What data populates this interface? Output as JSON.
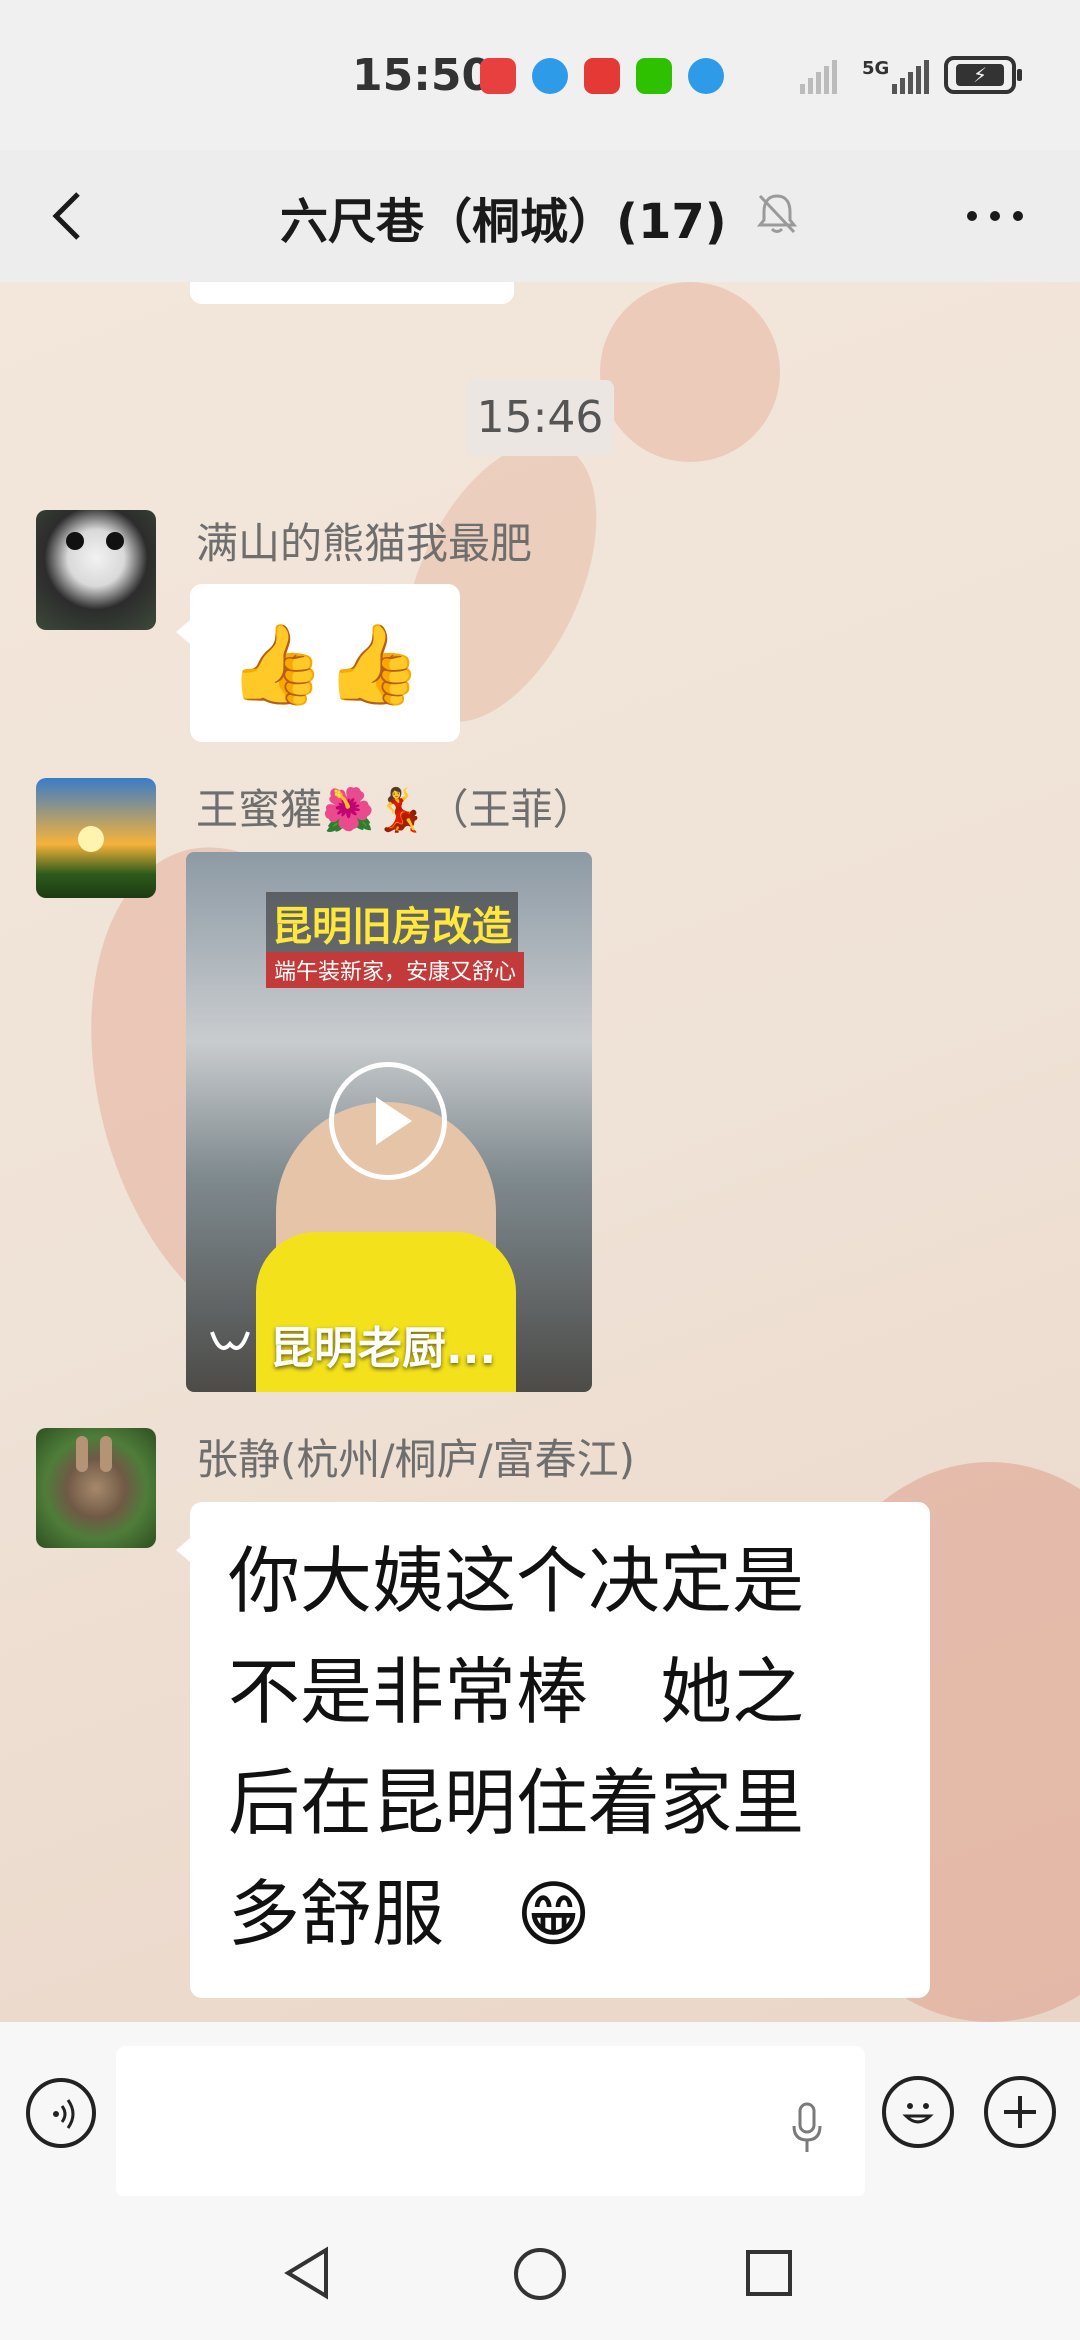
{
  "status_bar": {
    "time": "15:50",
    "network": "5G",
    "app_icons": [
      "huawei-app-icon",
      "browser-icon",
      "huawei-video-icon",
      "wechat-icon",
      "browser-icon"
    ]
  },
  "header": {
    "title": "六尺巷（桐城）(17)",
    "muted": true
  },
  "chat": {
    "timestamp": "15:46",
    "messages": [
      {
        "sender": "满山的熊猫我最肥",
        "type": "emoji",
        "content": "👍👍"
      },
      {
        "sender": "王蜜獾🌺💃（王菲）",
        "type": "video",
        "video_title": "昆明旧房改造",
        "video_subtitle": "端午装新家，安康又舒心",
        "video_label": "昆明老厨..."
      },
      {
        "sender": "张静(杭州/桐庐/富春江)",
        "type": "text",
        "lines": [
          "你大姨这个决定是",
          "不是非常棒　她之",
          "后在昆明住着家里",
          "多舒服　😁"
        ]
      }
    ]
  },
  "input_bar": {
    "placeholder": ""
  },
  "colors": {
    "header_bg": "#ededed",
    "bubble_bg": "#ffffff",
    "chat_bg": "#efe3d8"
  }
}
